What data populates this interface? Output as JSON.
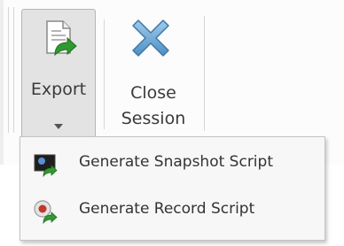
{
  "toolbar": {
    "export_label": "Export",
    "close_session_line1": "Close",
    "close_session_line2": "Session"
  },
  "export_menu": {
    "items": [
      {
        "label": "Generate Snapshot Script",
        "icon": "snapshot-script-icon"
      },
      {
        "label": "Generate Record Script",
        "icon": "record-script-icon"
      }
    ]
  },
  "icons": {
    "export": "export-document-arrow-icon",
    "close_session": "close-x-icon",
    "dropdown": "chevron-down-icon"
  },
  "colors": {
    "export_arrow": "#2f9a2f",
    "close_x": "#6aaad6",
    "record_red": "#c0392b"
  }
}
